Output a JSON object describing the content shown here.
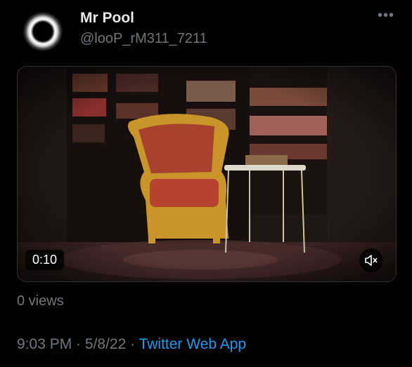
{
  "user": {
    "name": "Mr Pool",
    "handle": "@looP_rM311_7211",
    "avatar_icon": "eclipse-avatar-icon"
  },
  "more_label": "•••",
  "media": {
    "duration": "0:10",
    "mute_icon": "speaker-muted-icon"
  },
  "stats": {
    "views": "0 views"
  },
  "meta": {
    "time": "9:03 PM",
    "sep1": " · ",
    "date": "5/8/22",
    "sep2": " · ",
    "app": "Twitter Web App"
  },
  "colors": {
    "background": "#000000",
    "text": "#e7e9ea",
    "secondary": "#71767b",
    "link": "#1d9bf0"
  }
}
